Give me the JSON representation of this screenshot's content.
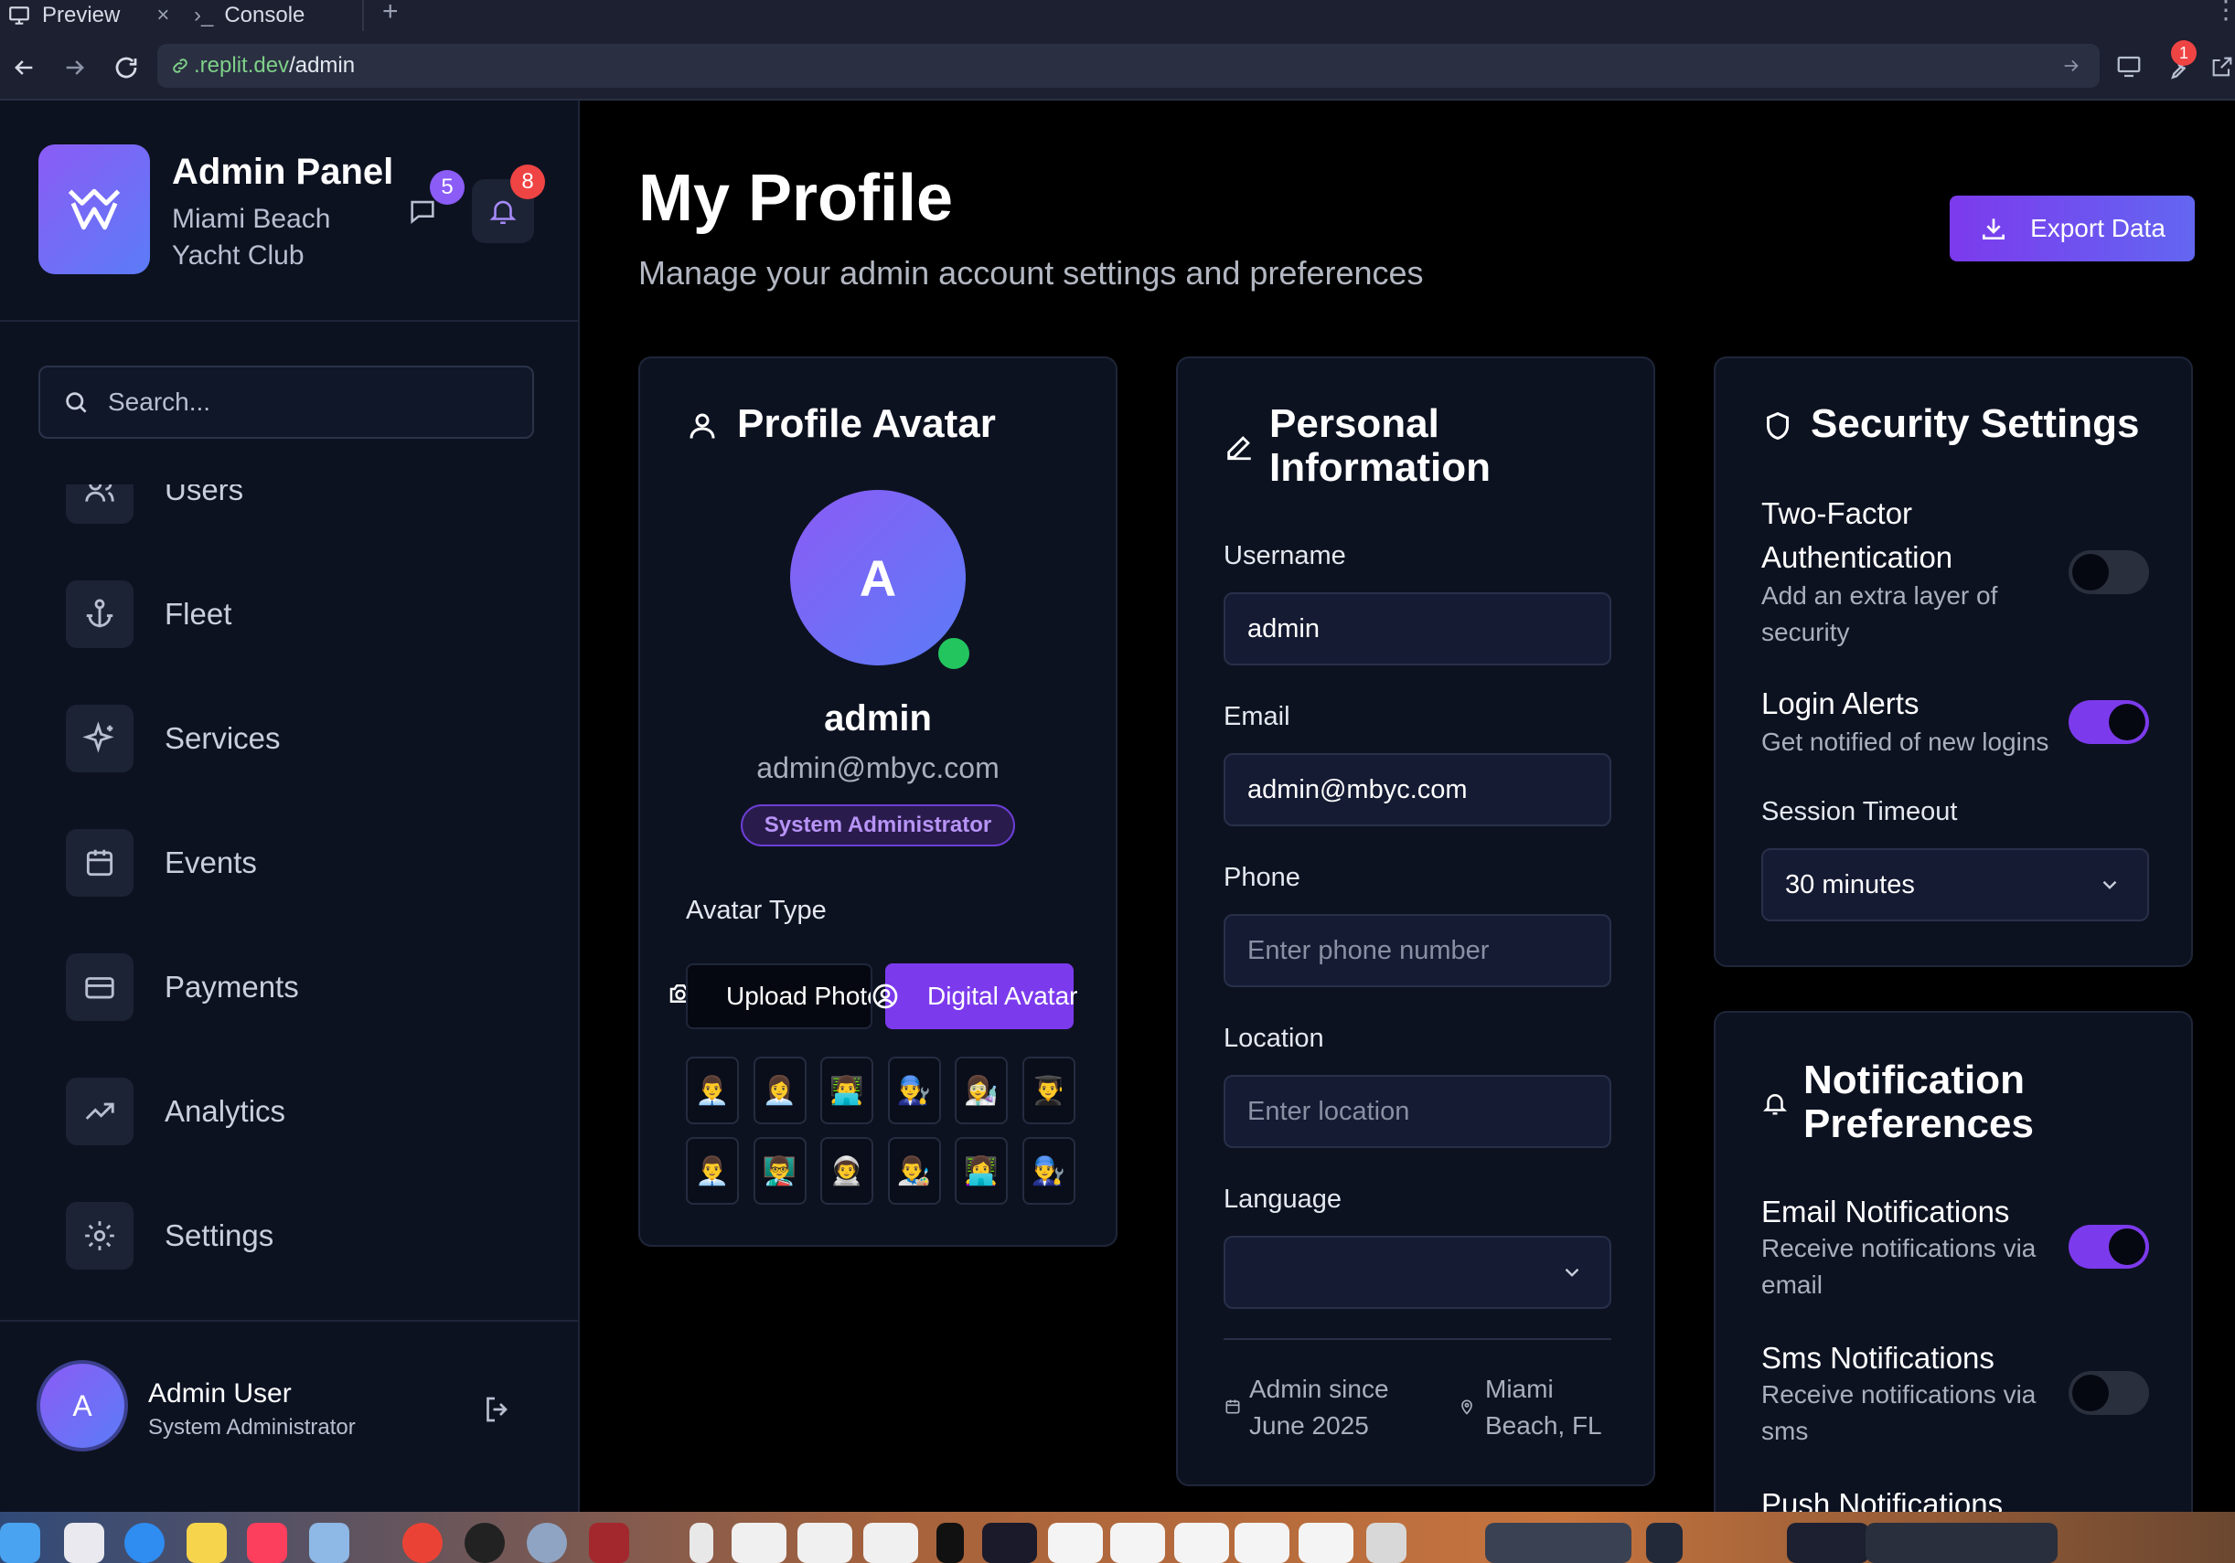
{
  "browser": {
    "tabs": [
      {
        "label": "Preview",
        "active": true
      },
      {
        "label": "Console",
        "active": false
      }
    ],
    "url_host": ".replit.dev",
    "url_path": "/admin",
    "notification_count": "1"
  },
  "sidebar": {
    "brand_title": "Admin Panel",
    "brand_subtitle": "Miami Beach Yacht Club",
    "message_badge": "5",
    "alert_badge": "8",
    "search_placeholder": "Search...",
    "nav_items": [
      {
        "label": "Users",
        "icon": "users-icon"
      },
      {
        "label": "Fleet",
        "icon": "anchor-icon"
      },
      {
        "label": "Services",
        "icon": "sparkles-icon"
      },
      {
        "label": "Events",
        "icon": "calendar-icon"
      },
      {
        "label": "Payments",
        "icon": "credit-card-icon"
      },
      {
        "label": "Analytics",
        "icon": "trending-up-icon"
      },
      {
        "label": "Settings",
        "icon": "gear-icon"
      }
    ],
    "user": {
      "initial": "A",
      "name": "Admin User",
      "role": "System Administrator"
    }
  },
  "header": {
    "title": "My Profile",
    "subtitle": "Manage your admin account settings and preferences",
    "export_label": "Export Data"
  },
  "avatar_card": {
    "title": "Profile Avatar",
    "initial": "A",
    "username": "admin",
    "email": "admin@mbyc.com",
    "role_badge": "System Administrator",
    "avatar_type_label": "Avatar Type",
    "upload_label": "Upload Photo",
    "digital_label": "Digital Avatar",
    "emoji_row1": [
      "👨‍💼",
      "👩‍💼",
      "👨‍💻",
      "👨‍🔧",
      "👩‍🔬",
      "👨‍🎓"
    ],
    "emoji_row2": [
      "👨‍💼",
      "👨‍🏫",
      "👨‍🚀",
      "👨‍🎨",
      "👩‍💻",
      "👨‍🔧"
    ]
  },
  "personal_card": {
    "title": "Personal Information",
    "username_label": "Username",
    "username_value": "admin",
    "email_label": "Email",
    "email_value": "admin@mbyc.com",
    "phone_label": "Phone",
    "phone_placeholder": "Enter phone number",
    "location_label": "Location",
    "location_placeholder": "Enter location",
    "language_label": "Language",
    "language_value": "",
    "admin_since": "Admin since June 2025",
    "admin_location": "Miami Beach, FL"
  },
  "security_card": {
    "title": "Security Settings",
    "two_factor_title": "Two-Factor Authentication",
    "two_factor_desc": "Add an extra layer of security",
    "two_factor_enabled": false,
    "login_alerts_title": "Login Alerts",
    "login_alerts_desc": "Get notified of new logins",
    "login_alerts_enabled": true,
    "session_label": "Session Timeout",
    "session_value": "30 minutes"
  },
  "notification_card": {
    "title": "Notification Preferences",
    "email_title": "Email Notifications",
    "email_desc": "Receive notifications via email",
    "email_enabled": true,
    "sms_title": "Sms Notifications",
    "sms_desc": "Receive notifications via sms",
    "sms_enabled": false,
    "push_title": "Push Notifications"
  },
  "colors": {
    "accent": "#7c3aed",
    "accent_blue": "#5b7cf7",
    "online": "#22c55e",
    "badge_red": "#ef4444"
  }
}
